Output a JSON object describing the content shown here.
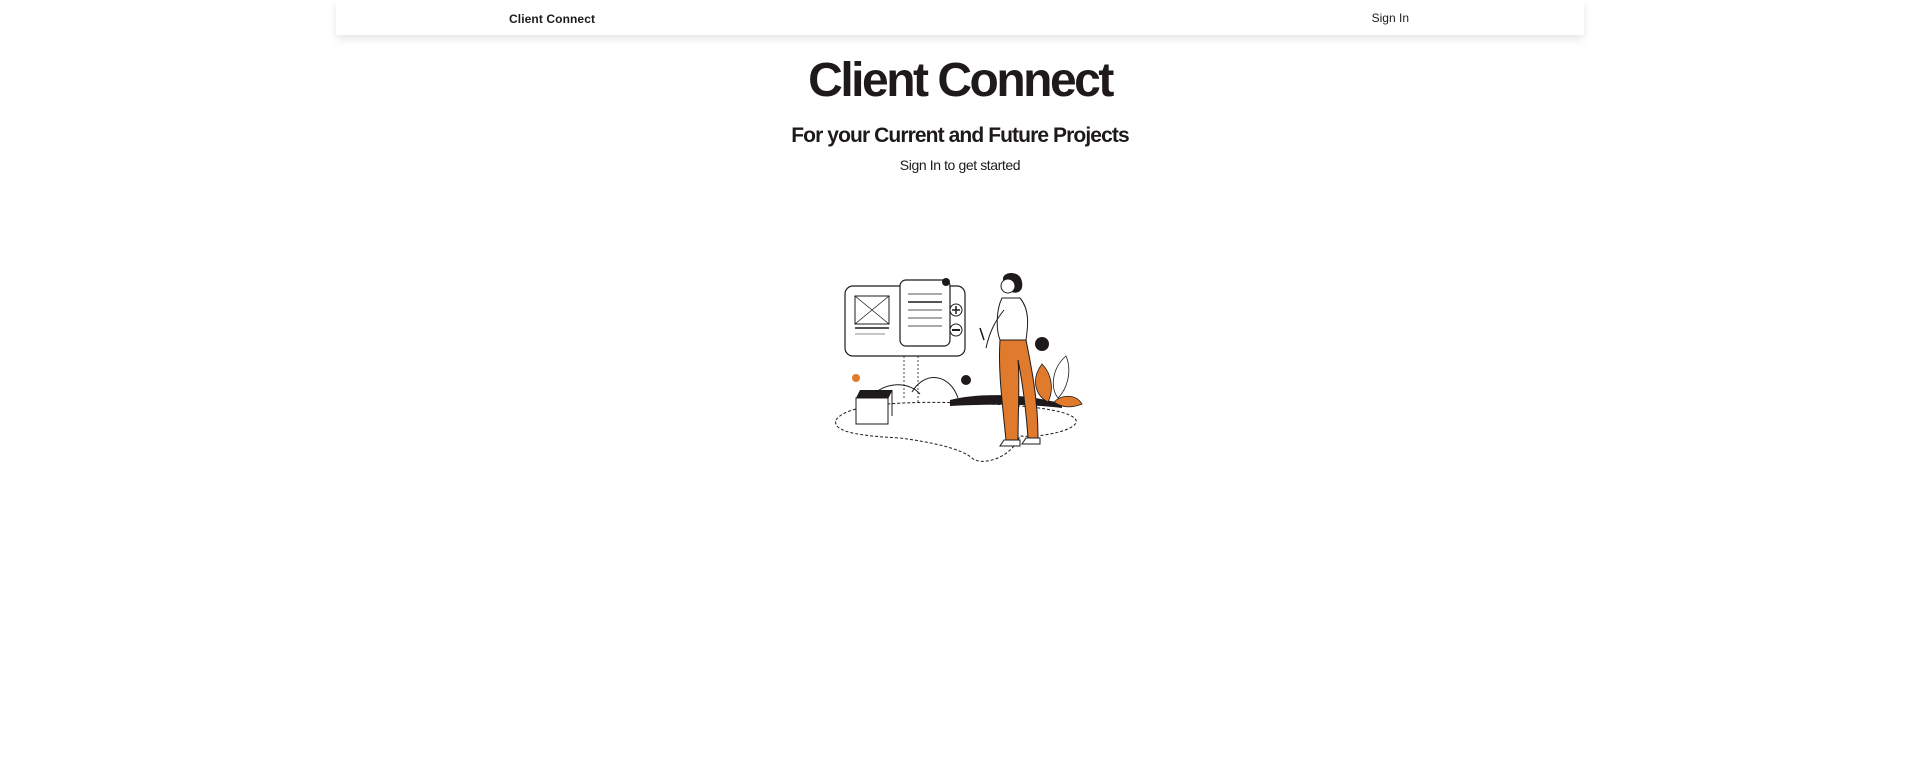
{
  "navbar": {
    "brand": "Client Connect",
    "sign_in_label": "Sign In"
  },
  "hero": {
    "title": "Client Connect",
    "subtitle": "For your Current and Future Projects",
    "cta_text": "Sign In to get started"
  },
  "illustration": {
    "icon": "person-with-project-board-illustration"
  },
  "colors": {
    "text": "#1e1a1c",
    "accent": "#e07a2c",
    "background": "#ffffff"
  }
}
